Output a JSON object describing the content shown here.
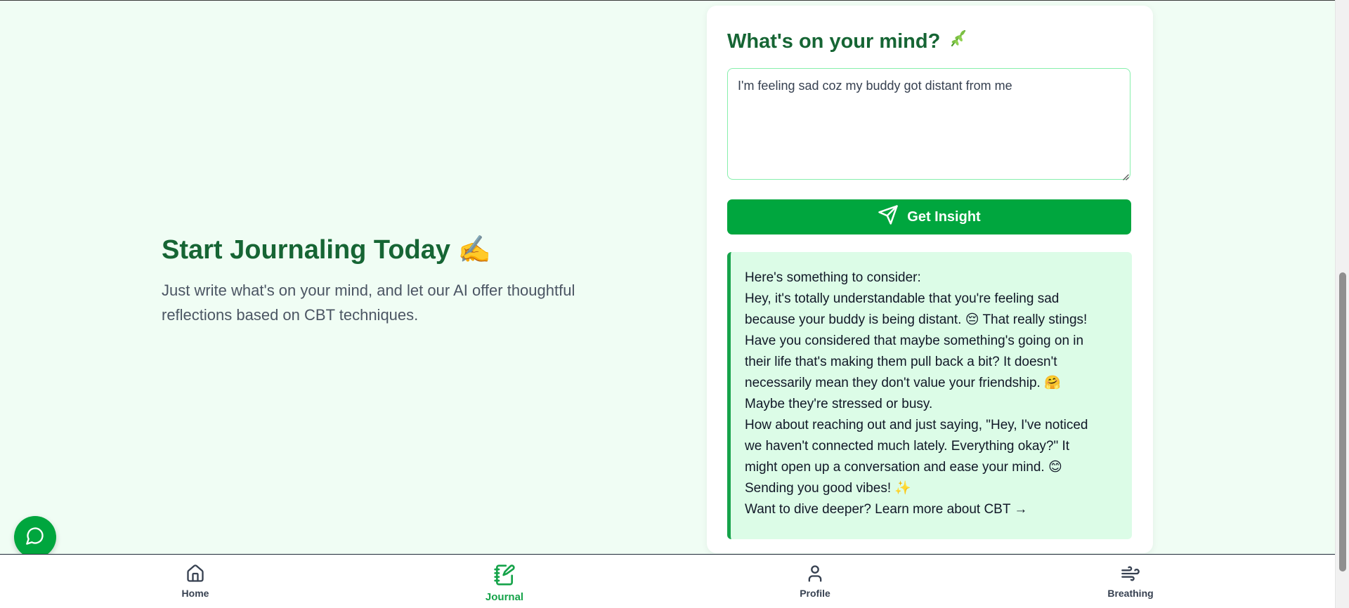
{
  "intro": {
    "title": "Start Journaling Today ✍️",
    "description": "Just write what's on your mind, and let our AI offer thoughtful reflections based on CBT techniques."
  },
  "journal": {
    "heading": "What's on your mind?",
    "heading_icon": "leaf-icon",
    "input_value": "I'm feeling sad coz my buddy got distant from me",
    "button_label": "Get Insight",
    "button_icon": "send-icon"
  },
  "insight": {
    "lines": [
      "Here's something to consider:",
      "Hey, it's totally understandable that you're feeling sad",
      "because your buddy is being distant. 😔 That really stings!",
      "Have you considered that maybe something's going on in",
      "their life that's making them pull back a bit? It doesn't",
      "necessarily mean they don't value your friendship. 🤗",
      "Maybe they're stressed or busy.",
      "How about reaching out and just saying, \"Hey, I've noticed",
      "we haven't connected much lately. Everything okay?\" It",
      "might open up a conversation and ease your mind. 😊",
      "Sending you good vibes! ✨"
    ],
    "link_text": "Want to dive deeper? Learn more about CBT →"
  },
  "nav": {
    "items": [
      {
        "label": "Home",
        "icon": "home-icon",
        "active": false
      },
      {
        "label": "Journal",
        "icon": "journal-icon",
        "active": true
      },
      {
        "label": "Profile",
        "icon": "profile-icon",
        "active": false
      },
      {
        "label": "Breathing",
        "icon": "wind-icon",
        "active": false
      }
    ]
  },
  "colors": {
    "page_background": "#f0fdf4",
    "brand_green": "#00a63e",
    "heading_green": "#166534",
    "response_background": "#dcfce7",
    "active_nav": "#16a34a"
  },
  "chat": {
    "icon": "chat-bubble-icon"
  }
}
